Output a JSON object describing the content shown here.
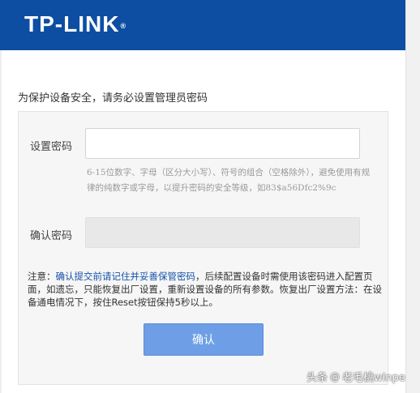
{
  "header": {
    "logo_text": "TP-LINK",
    "logo_mark": "®",
    "brand_color": "#0d4ea3"
  },
  "intro": "为保护设备安全，请务必设置管理员密码",
  "form": {
    "password_label": "设置密码",
    "password_value": "",
    "hint": "6-15位数字、字母（区分大小写）、符号的组合（空格除外），避免使用有规律的纯数字或字母，以提升密码的安全等级，如83$a56Dfc2%9c",
    "confirm_label": "确认密码",
    "confirm_value": ""
  },
  "note": {
    "prefix": "注意：",
    "emphasis": "确认提交前请记住并妥善保管密码",
    "rest": "，后续配置设备时需使用该密码进入配置页面，如遗忘，只能恢复出厂设置，重新设置设备的所有参数。恢复出厂设置方法：在设备通电情况下，按住Reset按钮保持5秒以上。"
  },
  "submit_label": "确认",
  "submit_color": "#6e9fe6",
  "watermark": {
    "source": "头条",
    "at": "@",
    "author": "老毛桃winpe"
  }
}
